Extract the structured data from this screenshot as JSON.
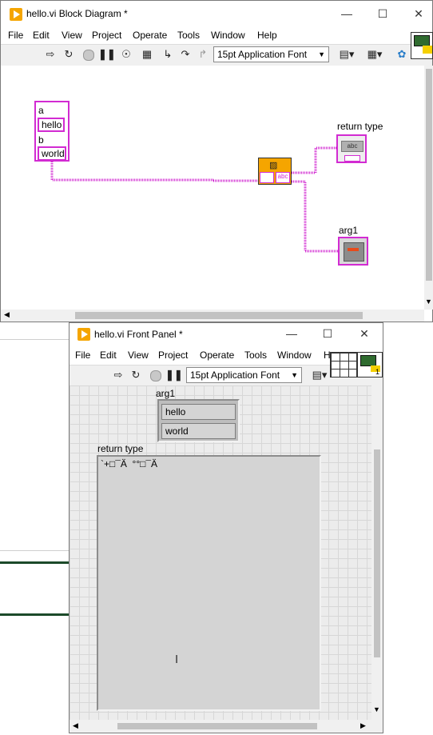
{
  "block_diagram": {
    "title": "hello.vi Block Diagram *",
    "menu": [
      "File",
      "Edit",
      "View",
      "Project",
      "Operate",
      "Tools",
      "Window",
      "Help"
    ],
    "font": "15pt Application Font",
    "constant_labels": [
      "a",
      "b"
    ],
    "constant_values": [
      "hello",
      "world"
    ],
    "indicator_return_type": "return type",
    "indicator_return_type_glyph": "abc",
    "indicator_arg1": "arg1",
    "node_glyph": "abc"
  },
  "front_panel": {
    "title": "hello.vi Front Panel *",
    "menu": [
      "File",
      "Edit",
      "View",
      "Project",
      "Operate",
      "Tools",
      "Window",
      "H"
    ],
    "font": "15pt Application Font",
    "arg1_label": "arg1",
    "arg1_values": [
      "hello",
      "world"
    ],
    "return_type_label": "return type",
    "return_type_value": "`+□¯Ä  °°□¯Ä",
    "connector_num": "1"
  },
  "colors": {
    "string_wire": "#d22bd2",
    "node_orange": "#f5a500",
    "panel_bg": "#ececec"
  }
}
